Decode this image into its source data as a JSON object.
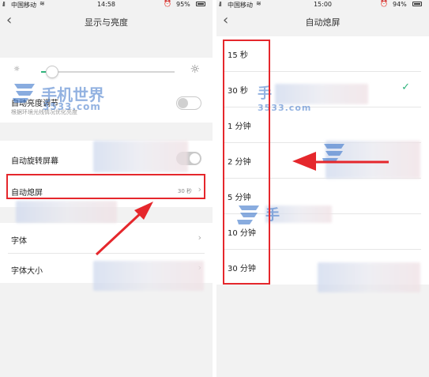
{
  "left_screen": {
    "status": {
      "signal": "ᵢll",
      "carrier": "中国移动",
      "wifi": "≋",
      "time": "14:58",
      "alarm": "⏰",
      "battery": "95%"
    },
    "title": "显示与亮度",
    "brightness": {
      "level_fraction": 0.08
    },
    "auto_brightness": {
      "label": "自动亮度调节",
      "description": "根据环境光线情况优化亮度",
      "enabled": false
    },
    "auto_rotate": {
      "label": "自动旋转屏幕",
      "enabled": true
    },
    "auto_lock": {
      "label": "自动熄屏",
      "value": "30 秒"
    },
    "font": {
      "label": "字体"
    },
    "font_size": {
      "label": "字体大小"
    }
  },
  "right_screen": {
    "status": {
      "signal": "ᵢll",
      "carrier": "中国移动",
      "wifi": "≋",
      "time": "15:00",
      "alarm": "⏰",
      "battery": "94%"
    },
    "title": "自动熄屏",
    "options": [
      {
        "label": "15 秒"
      },
      {
        "label": "30 秒",
        "selected": true
      },
      {
        "label": "1 分钟"
      },
      {
        "label": "2 分钟"
      },
      {
        "label": "5 分钟"
      },
      {
        "label": "10 分钟"
      },
      {
        "label": "30 分钟"
      }
    ]
  },
  "watermark": {
    "name": "手机世界",
    "domain": "3533.com"
  },
  "colors": {
    "accent": "#2fb47c",
    "highlight": "#e5272c",
    "arrow": "#e5272c",
    "watermark": "#3b75c9"
  }
}
